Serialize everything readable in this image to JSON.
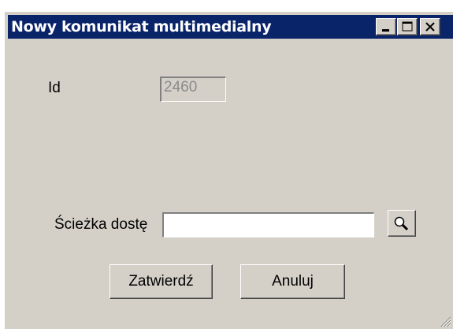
{
  "window": {
    "title": "Nowy komunikat multimedialny"
  },
  "form": {
    "id_label": "Id",
    "id_value": "2460",
    "path_label": "Ścieżka dostę",
    "path_value": ""
  },
  "buttons": {
    "confirm_label": "Zatwierdź",
    "cancel_label": "Anuluj"
  },
  "icons": {
    "minimize": "minimize-icon",
    "maximize": "maximize-icon",
    "close": "close-icon",
    "browse": "magnifier-icon",
    "resize": "resize-grip-icon"
  },
  "colors": {
    "titlebar": "#0a246a",
    "window_bg": "#d4d0c8"
  }
}
